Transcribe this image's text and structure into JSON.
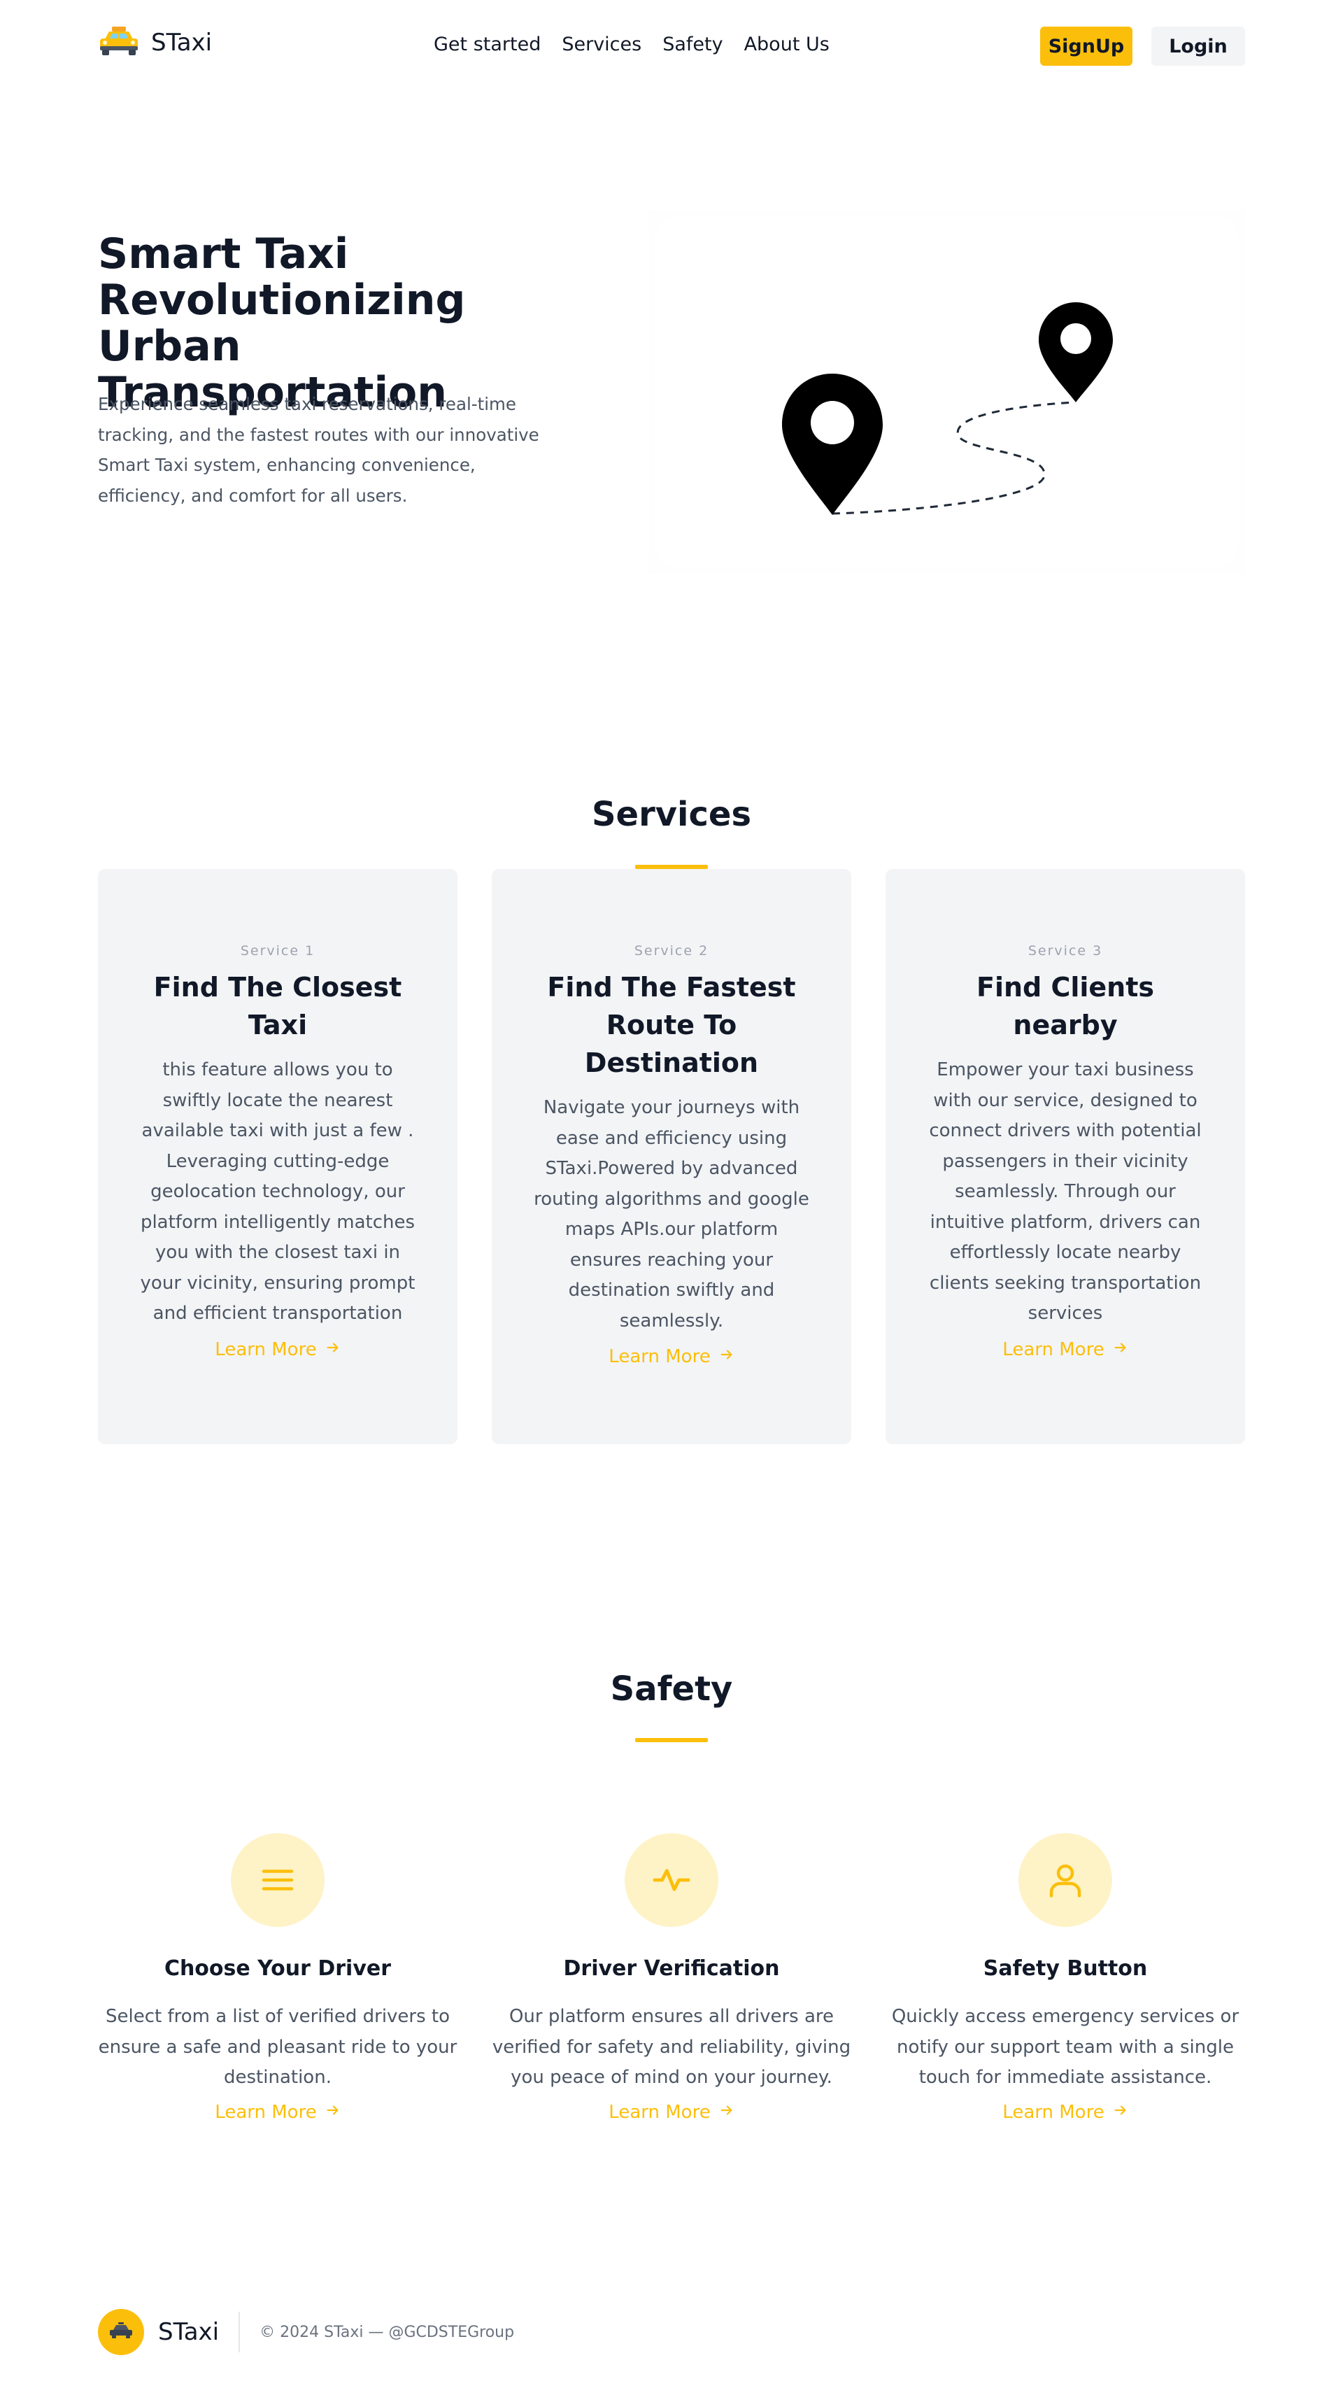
{
  "brand": {
    "name": "STaxi"
  },
  "nav": {
    "links": [
      "Get started",
      "Services",
      "Safety",
      "About Us"
    ],
    "signup_label": "SignUp",
    "login_label": "Login"
  },
  "hero": {
    "title": "Smart Taxi Revolutionizing Urban Transportation",
    "text": "Experience seamless taxi reservations, real-time tracking, and the fastest routes with our innovative Smart Taxi system, enhancing convenience, efficiency, and comfort for all users."
  },
  "services": {
    "title": "Services",
    "cards": [
      {
        "tag": "Service 1",
        "title": "Find The Closest Taxi",
        "text": "this feature allows you to swiftly locate the nearest available taxi with just a few . Leveraging cutting-edge geolocation technology, our platform intelligently matches you with the closest taxi in your vicinity, ensuring prompt and efficient transportation",
        "link": "Learn More"
      },
      {
        "tag": "Service 2",
        "title": "Find The Fastest Route To Destination",
        "text": "Navigate your journeys with ease and efficiency using STaxi.Powered by advanced routing algorithms and google maps APIs.our platform ensures reaching your destination swiftly and seamlessly.",
        "link": "Learn More"
      },
      {
        "tag": "Service 3",
        "title": "Find Clients nearby",
        "text": "Empower your taxi business with our service, designed to connect drivers with potential passengers in their vicinity seamlessly. Through our intuitive platform, drivers can effortlessly locate nearby clients seeking transportation services",
        "link": "Learn More"
      }
    ]
  },
  "safety": {
    "title": "Safety",
    "features": [
      {
        "icon": "menu-icon",
        "title": "Choose Your Driver",
        "text": "Select from a list of verified drivers to ensure a safe and pleasant ride to your destination.",
        "link": "Learn More"
      },
      {
        "icon": "pulse-icon",
        "title": "Driver Verification",
        "text": "Our platform ensures all drivers are verified for safety and reliability, giving you peace of mind on your journey.",
        "link": "Learn More"
      },
      {
        "icon": "user-icon",
        "title": "Safety Button",
        "text": "Quickly access emergency services or notify our support team with a single touch for immediate assistance.",
        "link": "Learn More"
      }
    ]
  },
  "footer": {
    "name": "STaxi",
    "copyright": "© 2024 STaxi — @GCDSTEGroup"
  },
  "colors": {
    "accent": "#fbbf0b",
    "accent_light": "#fef3c7",
    "card_bg": "#f3f4f6"
  }
}
